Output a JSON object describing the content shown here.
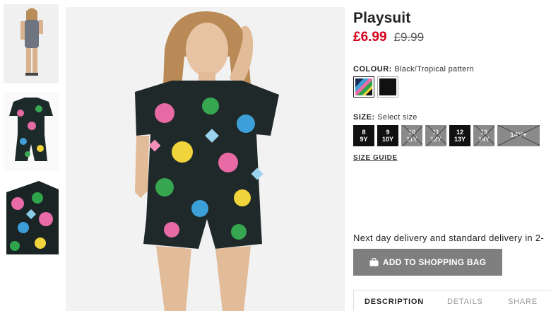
{
  "product": {
    "title": "Playsuit",
    "price_current": "£6.99",
    "price_original": "£9.99"
  },
  "colour": {
    "label": "COLOUR:",
    "selected_value": "Black/Tropical pattern",
    "swatches": [
      {
        "name": "Black/Tropical pattern",
        "selected": true
      },
      {
        "name": "Black",
        "selected": false
      }
    ]
  },
  "size": {
    "label": "SIZE:",
    "prompt": "Select size",
    "options": [
      {
        "line1": "8",
        "line2": "9Y",
        "available": true
      },
      {
        "line1": "9",
        "line2": "10Y",
        "available": true
      },
      {
        "line1": "10",
        "line2": "11Y",
        "available": false
      },
      {
        "line1": "11",
        "line2": "12Y",
        "available": false
      },
      {
        "line1": "12",
        "line2": "13Y",
        "available": true
      },
      {
        "line1": "13",
        "line2": "14Y",
        "available": false
      },
      {
        "line1": "14Y+",
        "line2": "",
        "available": false
      }
    ],
    "guide_label": "SIZE GUIDE"
  },
  "delivery_text": "Next day delivery and standard delivery in 2-",
  "add_to_bag_label": "ADD TO SHOPPING BAG",
  "tabs": [
    "DESCRIPTION",
    "DETAILS",
    "SHARE"
  ],
  "colors": {
    "price_red": "#d6001c",
    "button_grey": "#7f7f7f",
    "size_available": "#111111",
    "size_unavailable": "#8a8a8a"
  }
}
